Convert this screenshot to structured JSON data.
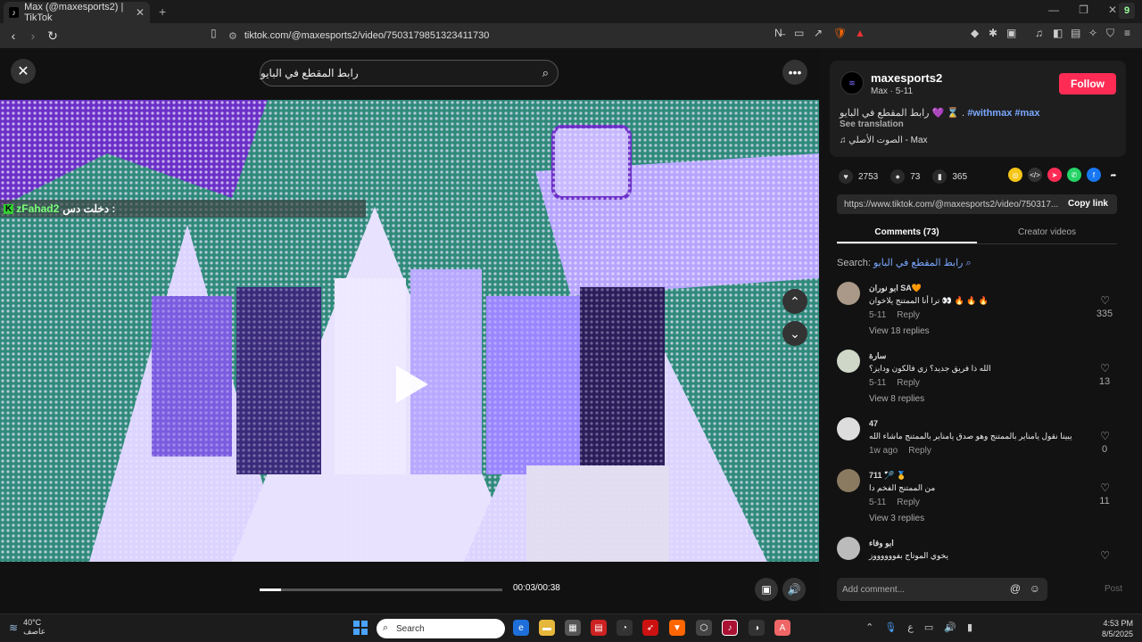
{
  "browser": {
    "tab_title": "Max (@maxesports2) | TikTok",
    "tab_fav": "♪",
    "url": "tiktok.com/@maxesports2/video/7503179851323411730",
    "k_badge": "9"
  },
  "video": {
    "search_text": "رابط المقطع في البايو",
    "overlay_user": "zFahad2",
    "overlay_msg": "دخلت دس :",
    "time": "00:03/00:38",
    "progress_fraction": 0.09,
    "overlay_k": "K"
  },
  "author": {
    "name": "maxesports2",
    "sub": "Max · 5-11",
    "follow_label": "Follow",
    "desc_arabic": "رابط المقطع في البايو 💜 ⌛ .",
    "tags": "#withmax #max",
    "see_translation": "See translation",
    "music": "الصوت الأصلي - Max",
    "avatar_text": "≋"
  },
  "stats": {
    "likes": "2753",
    "comments": "73",
    "saves": "365"
  },
  "link": {
    "url": "https://www.tiktok.com/@maxesports2/video/750317...",
    "copy_label": "Copy link"
  },
  "tabs": {
    "comments": "Comments (73)",
    "creator": "Creator videos"
  },
  "search": {
    "label": "Search:",
    "query": "رابط المقطع في البايو"
  },
  "comments": [
    {
      "name": "ابو نوران SA🧡",
      "text": "ترا أنا الممتنج يلاخوان 👀 🔥 🔥 🔥",
      "date": "5-11",
      "reply": "Reply",
      "replies": "View 18 replies",
      "likes": "335"
    },
    {
      "name": "سارة",
      "text": "الله ذا فريق جديد؟ زي فالكون ودايز؟",
      "date": "5-11",
      "reply": "Reply",
      "replies": "View 8 replies",
      "likes": "13"
    },
    {
      "name": "47",
      "text": "يبينا نقول يامناير بالممتنج وهو صدق يامناير بالممتنج ماشاء الله",
      "date": "1w ago",
      "reply": "Reply",
      "replies": "",
      "likes": "0"
    },
    {
      "name": "711 🏸 🥇",
      "text": "من الممتنج الفخم دا",
      "date": "5-11",
      "reply": "Reply",
      "replies": "View 3 replies",
      "likes": "11"
    },
    {
      "name": "ابو وفاء",
      "text": "يخوي الموتاج بفووووووز",
      "date": "",
      "reply": "",
      "replies": "",
      "likes": ""
    }
  ],
  "composer": {
    "placeholder": "Add comment...",
    "post": "Post"
  },
  "taskbar": {
    "temp": "40°C",
    "weather_desc": "عاصف",
    "search": "Search",
    "time": "4:53 PM",
    "date": "8/5/2025",
    "lang": "ع"
  },
  "colors": {
    "follow": "#fe2c55",
    "tag": "#7aa8ff"
  }
}
